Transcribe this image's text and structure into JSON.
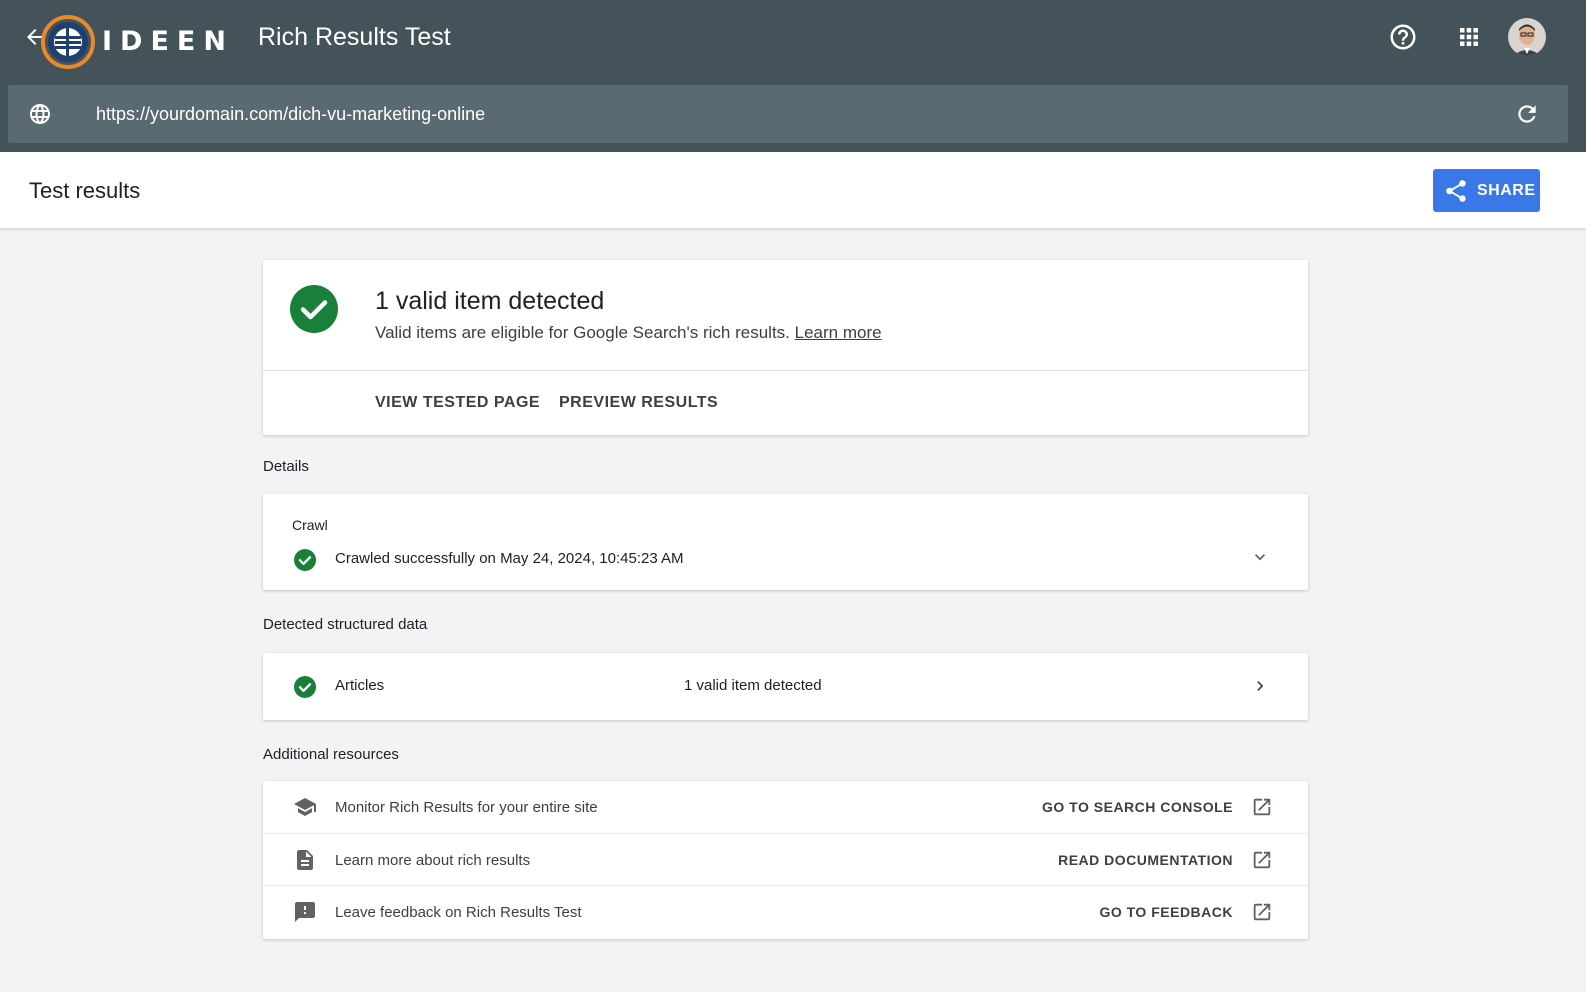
{
  "header": {
    "logo_text": "IDEEN",
    "app_title": "Rich Results Test"
  },
  "urlbar": {
    "url": "https://yourdomain.com/dich-vu-marketing-online"
  },
  "subheader": {
    "title": "Test results",
    "share_label": "SHARE"
  },
  "summary": {
    "title": "1 valid item detected",
    "subtitle": "Valid items are eligible for Google Search's rich results.",
    "learn_more": "Learn more",
    "tabs": [
      "VIEW TESTED PAGE",
      "PREVIEW RESULTS"
    ]
  },
  "details": {
    "section_label": "Details",
    "crawl_label": "Crawl",
    "crawl_status": "Crawled successfully on May 24, 2024, 10:45:23 AM"
  },
  "structured_data": {
    "section_label": "Detected structured data",
    "items": [
      {
        "name": "Articles",
        "status": "1 valid item detected"
      }
    ]
  },
  "resources": {
    "section_label": "Additional resources",
    "items": [
      {
        "text": "Monitor Rich Results for your entire site",
        "action": "GO TO SEARCH CONSOLE",
        "icon": "school-icon"
      },
      {
        "text": "Learn more about rich results",
        "action": "READ DOCUMENTATION",
        "icon": "document-icon"
      },
      {
        "text": "Leave feedback on Rich Results Test",
        "action": "GO TO FEEDBACK",
        "icon": "feedback-icon"
      }
    ]
  },
  "colors": {
    "topbar": "#445259",
    "success": "#188038",
    "primary": "#3b78e7"
  }
}
